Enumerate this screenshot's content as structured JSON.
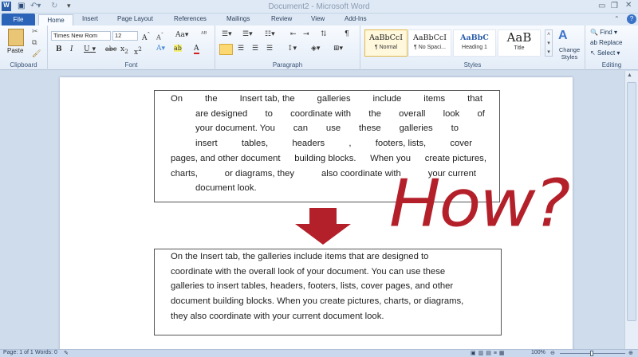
{
  "window": {
    "title": "Document2 - Microsoft Word"
  },
  "tabs": [
    "File",
    "Home",
    "Insert",
    "Page Layout",
    "References",
    "Mailings",
    "Review",
    "View",
    "Add-Ins"
  ],
  "ribbon": {
    "clipboard": {
      "paste": "Paste",
      "label": "Clipboard"
    },
    "font": {
      "name": "Times New Rom",
      "size": "12",
      "label": "Font"
    },
    "paragraph": {
      "label": "Paragraph"
    },
    "styles": {
      "items": [
        {
          "preview": "AaBbCcI",
          "name": "¶ Normal"
        },
        {
          "preview": "AaBbCcI",
          "name": "¶ No Spaci..."
        },
        {
          "preview": "AaBbC",
          "name": "Heading 1"
        },
        {
          "preview": "AaB",
          "name": "Title"
        }
      ],
      "change": "Change Styles",
      "label": "Styles"
    },
    "editing": {
      "find": "Find",
      "replace": "Replace",
      "select": "Select",
      "label": "Editing"
    }
  },
  "document": {
    "box1_lines": [
      [
        "On",
        "the",
        "Insert tab, the",
        "galleries",
        "include",
        "items",
        "that"
      ],
      [
        "are designed",
        "to",
        "coordinate with",
        "the",
        "overall",
        "look",
        "of"
      ],
      [
        "your document. You",
        "can",
        "use",
        "these",
        "galleries",
        "to"
      ],
      [
        "insert",
        "tables,",
        "headers",
        ",",
        "footers, lists,",
        "cover"
      ],
      [
        "pages, and other document",
        "building blocks.",
        "When you",
        "create pictures,"
      ],
      [
        "charts,",
        "or diagrams, they",
        "also coordinate with",
        "your current"
      ],
      [
        "document look."
      ]
    ],
    "box2_lines": [
      "On the Insert tab, the galleries include items that are designed to",
      "coordinate with the overall look of your document. You can use these",
      "galleries to insert tables, headers, footers, lists, cover pages, and other",
      "document building blocks. When you create pictures, charts, or diagrams,",
      "they also coordinate with your current document look."
    ],
    "annotation": "How?"
  },
  "status": {
    "page": "Page: 1 of 1",
    "words": "Words: 0",
    "zoom": "100%"
  },
  "colors": {
    "accent": "#2a63b8",
    "arrow": "#b4202a"
  }
}
